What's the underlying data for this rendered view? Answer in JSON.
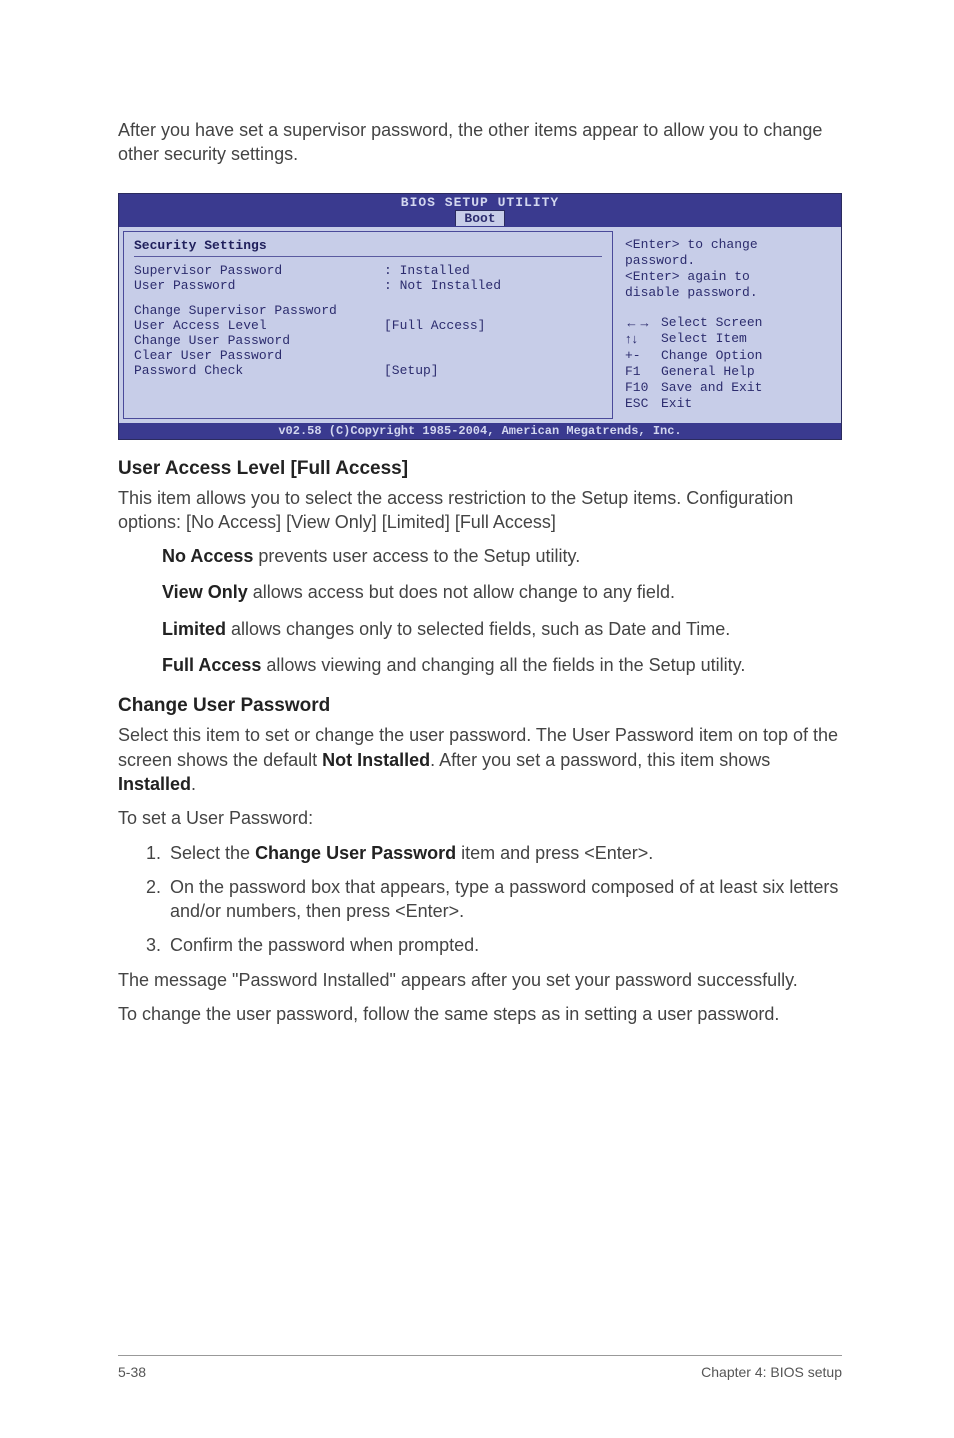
{
  "intro": "After you have set a supervisor password, the other items appear to allow you to change other security settings.",
  "bios": {
    "title": "BIOS SETUP UTILITY",
    "tab": "Boot",
    "section_header": "Security Settings",
    "rows": {
      "supervisor_pw_label": "Supervisor Password",
      "supervisor_pw_value": ": Installed",
      "user_pw_label": "User Password",
      "user_pw_value": ": Not Installed",
      "change_sup": "Change Supervisor Password",
      "user_access_label": "User Access Level",
      "user_access_value": "[Full Access]",
      "change_user": "Change User Password",
      "clear_user": "Clear User Password",
      "pwcheck_label": "Password Check",
      "pwcheck_value": "[Setup]"
    },
    "help_top": {
      "l1": "<Enter> to change",
      "l2": "password.",
      "l3": "<Enter> again to",
      "l4": "disable password."
    },
    "help_bottom": {
      "select_screen_key": "←→",
      "select_screen": "Select Screen",
      "select_item_key": "↑↓",
      "select_item": "Select Item",
      "change_opt_key": "+-",
      "change_opt": "Change Option",
      "gen_help_key": "F1",
      "gen_help": "General Help",
      "save_key": "F10",
      "save": "Save and Exit",
      "esc_key": "ESC",
      "esc": "Exit"
    },
    "footer": "v02.58 (C)Copyright 1985-2004, American Megatrends, Inc."
  },
  "ual": {
    "heading": "User Access Level [Full Access]",
    "p1": "This item allows you to select the access restriction to the Setup items. Configuration options: [No Access] [View Only] [Limited] [Full Access]",
    "no_access_b": "No Access",
    "no_access_t": " prevents user access to the Setup utility.",
    "view_only_b": "View Only",
    "view_only_t": " allows access but does not allow change to any field.",
    "limited_b": "Limited",
    "limited_t": " allows changes only to selected fields, such as Date and Time.",
    "full_access_b": "Full Access",
    "full_access_t": " allows viewing and changing all the fields in the Setup utility."
  },
  "cup": {
    "heading": "Change User Password",
    "p1a": "Select this item to set or change the user password. The User Password item on top of the screen shows the default ",
    "p1b": "Not Installed",
    "p1c": ". After you set a password, this item shows ",
    "p1d": "Installed",
    "p1e": ".",
    "p2": "To set a User Password:",
    "step1a": "Select the ",
    "step1b": "Change User Password",
    "step1c": " item and press <Enter>.",
    "step2": "On the password box that appears, type a password composed of at least six letters and/or numbers, then press <Enter>.",
    "step3": "Confirm the password when prompted.",
    "p3": "The message \"Password Installed\" appears after you set your password successfully.",
    "p4": "To change the user password, follow the same steps as in setting a user password."
  },
  "footer": {
    "left": "5-38",
    "right": "Chapter 4: BIOS setup"
  }
}
